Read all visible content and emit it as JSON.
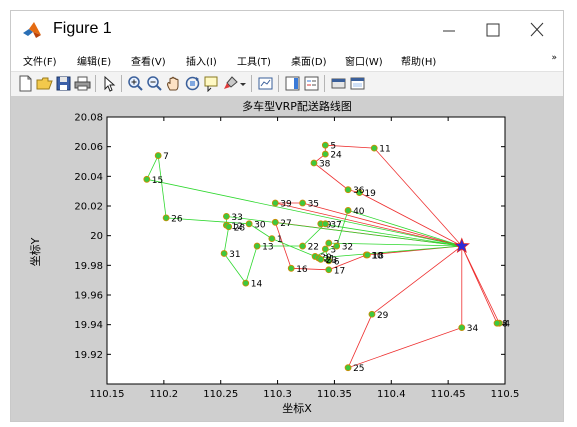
{
  "window": {
    "title": "Figure 1",
    "controls": {
      "minimize": "minimize",
      "maximize": "maximize",
      "close": "close"
    }
  },
  "menu": {
    "items": [
      "文件(F)",
      "编辑(E)",
      "查看(V)",
      "插入(I)",
      "工具(T)",
      "桌面(D)",
      "窗口(W)",
      "帮助(H)"
    ],
    "overflow": "»"
  },
  "toolbar": {
    "icons": [
      "new-figure-icon",
      "open-icon",
      "save-icon",
      "print-icon",
      "pointer-icon",
      "zoom-in-icon",
      "zoom-out-icon",
      "pan-icon",
      "rotate-3d-icon",
      "data-cursor-icon",
      "brush-icon",
      "link-plot-icon",
      "colorbar-icon",
      "legend-icon",
      "hide-plot-tools-icon",
      "show-plot-tools-icon"
    ]
  },
  "chart_data": {
    "type": "scatter",
    "title": "多车型VRP配送路线图",
    "xlabel": "坐标X",
    "ylabel": "坐标Y",
    "xlim": [
      110.15,
      110.5
    ],
    "ylim": [
      19.9,
      20.08
    ],
    "x_ticks": [
      "110.15",
      "110.2",
      "110.25",
      "110.3",
      "110.35",
      "110.4",
      "110.45",
      "110.5"
    ],
    "y_ticks": [
      "19.92",
      "19.94",
      "19.96",
      "19.98",
      "20",
      "20.02",
      "20.04",
      "20.06",
      "20.08"
    ],
    "grid": false,
    "depot": {
      "x": 110.462,
      "y": 19.993,
      "color": "#2b2bd8",
      "edge": "#e02020"
    },
    "node_color": "#3ec83e",
    "node_edge": "#d08a00",
    "route_colors": {
      "red": "#ee3030",
      "green": "#2fd82f"
    },
    "nodes": [
      {
        "id": "1",
        "x": 110.295,
        "y": 19.998
      },
      {
        "id": "2",
        "x": 110.345,
        "y": 19.995
      },
      {
        "id": "3",
        "x": 110.342,
        "y": 19.991
      },
      {
        "id": "4",
        "x": 110.495,
        "y": 19.941
      },
      {
        "id": "5",
        "x": 110.342,
        "y": 20.061
      },
      {
        "id": "6",
        "x": 110.345,
        "y": 19.983
      },
      {
        "id": "7",
        "x": 110.195,
        "y": 20.054
      },
      {
        "id": "8",
        "x": 110.493,
        "y": 19.941
      },
      {
        "id": "9",
        "x": 110.338,
        "y": 20.008
      },
      {
        "id": "10",
        "x": 110.378,
        "y": 19.987
      },
      {
        "id": "11",
        "x": 110.385,
        "y": 20.059
      },
      {
        "id": "12",
        "x": 110.255,
        "y": 20.007
      },
      {
        "id": "13",
        "x": 110.282,
        "y": 19.993
      },
      {
        "id": "14",
        "x": 110.272,
        "y": 19.968
      },
      {
        "id": "15",
        "x": 110.185,
        "y": 20.038
      },
      {
        "id": "16",
        "x": 110.312,
        "y": 19.978
      },
      {
        "id": "17",
        "x": 110.345,
        "y": 19.977
      },
      {
        "id": "18",
        "x": 110.379,
        "y": 19.987
      },
      {
        "id": "19",
        "x": 110.372,
        "y": 20.029
      },
      {
        "id": "20",
        "x": 110.333,
        "y": 19.986
      },
      {
        "id": "21",
        "x": 110.336,
        "y": 19.985
      },
      {
        "id": "22",
        "x": 110.322,
        "y": 19.993
      },
      {
        "id": "23",
        "x": 110.338,
        "y": 19.984
      },
      {
        "id": "24",
        "x": 110.342,
        "y": 20.055
      },
      {
        "id": "25",
        "x": 110.362,
        "y": 19.911
      },
      {
        "id": "26",
        "x": 110.202,
        "y": 20.012
      },
      {
        "id": "27",
        "x": 110.298,
        "y": 20.009
      },
      {
        "id": "28",
        "x": 110.257,
        "y": 20.006
      },
      {
        "id": "29",
        "x": 110.383,
        "y": 19.947
      },
      {
        "id": "30",
        "x": 110.275,
        "y": 20.008
      },
      {
        "id": "31",
        "x": 110.253,
        "y": 19.988
      },
      {
        "id": "32",
        "x": 110.352,
        "y": 19.993
      },
      {
        "id": "33",
        "x": 110.255,
        "y": 20.013
      },
      {
        "id": "34",
        "x": 110.462,
        "y": 19.938
      },
      {
        "id": "35",
        "x": 110.322,
        "y": 20.022
      },
      {
        "id": "36",
        "x": 110.362,
        "y": 20.031
      },
      {
        "id": "37",
        "x": 110.342,
        "y": 20.008
      },
      {
        "id": "38",
        "x": 110.332,
        "y": 20.049
      },
      {
        "id": "39",
        "x": 110.298,
        "y": 20.022
      },
      {
        "id": "40",
        "x": 110.362,
        "y": 20.017
      }
    ],
    "routes": [
      {
        "color": "red",
        "path": [
          "0",
          "11",
          "5",
          "24",
          "38",
          "36",
          "19",
          "0"
        ]
      },
      {
        "color": "red",
        "path": [
          "0",
          "34",
          "25",
          "29",
          "0"
        ]
      },
      {
        "color": "red",
        "path": [
          "0",
          "8",
          "4",
          "0"
        ]
      },
      {
        "color": "red",
        "path": [
          "0",
          "39",
          "35",
          "0"
        ]
      },
      {
        "color": "red",
        "path": [
          "0",
          "27",
          "16",
          "17",
          "10",
          "18",
          "0"
        ]
      },
      {
        "color": "green",
        "path": [
          "0",
          "9",
          "37",
          "22",
          "13",
          "14",
          "31",
          "28",
          "12",
          "33",
          "0"
        ]
      },
      {
        "color": "green",
        "path": [
          "0",
          "40",
          "32",
          "20",
          "1",
          "30",
          "26",
          "7",
          "15",
          "0"
        ]
      },
      {
        "color": "green",
        "path": [
          "0",
          "2",
          "3",
          "6",
          "23",
          "21",
          "0"
        ]
      }
    ]
  }
}
